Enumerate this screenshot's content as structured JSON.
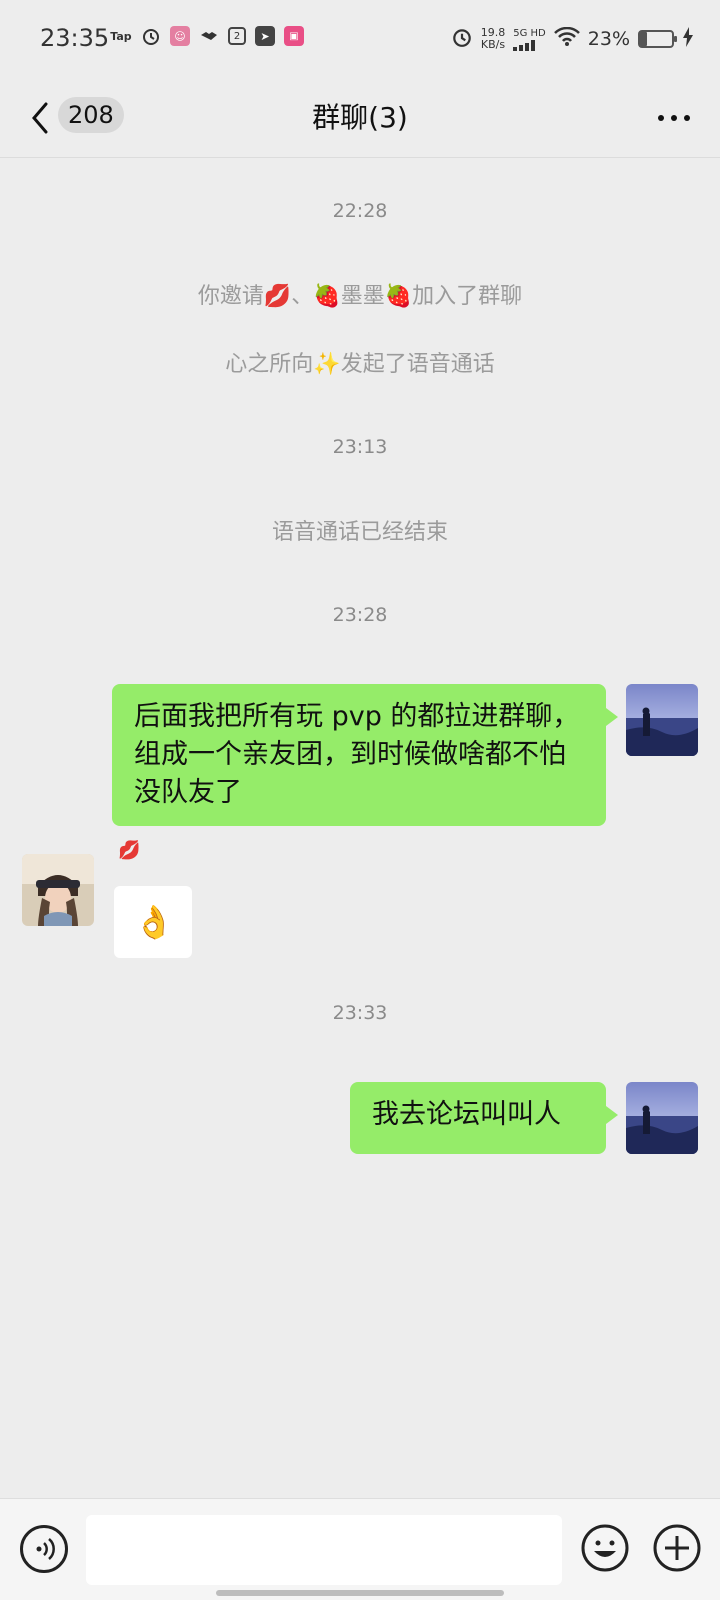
{
  "status_bar": {
    "time": "23:35",
    "tap_label": "Tap",
    "speed_value": "19.8",
    "speed_unit": "KB/s",
    "network_label": "5G HD",
    "battery_pct": "23%",
    "battery_level": 0.23
  },
  "header": {
    "unread_count": "208",
    "title": "群聊(3)"
  },
  "chat": {
    "ts1": "22:28",
    "sys1": "你邀请💋、🍓墨墨🍓加入了群聊",
    "sys2": "心之所向✨发起了语音通话",
    "ts2": "23:13",
    "sys3": "语音通话已经结束",
    "ts3": "23:28",
    "msg1": "后面我把所有玩 pvp 的都拉进群聊，组成一个亲友团，到时候做啥都不怕没队友了",
    "sender2_name": "💋",
    "msg2": "👌",
    "ts4": "23:33",
    "msg3": "我去论坛叫叫人"
  },
  "colors": {
    "background": "#ededed",
    "bubble_self": "#95ec69",
    "bubble_other": "#ffffff"
  }
}
